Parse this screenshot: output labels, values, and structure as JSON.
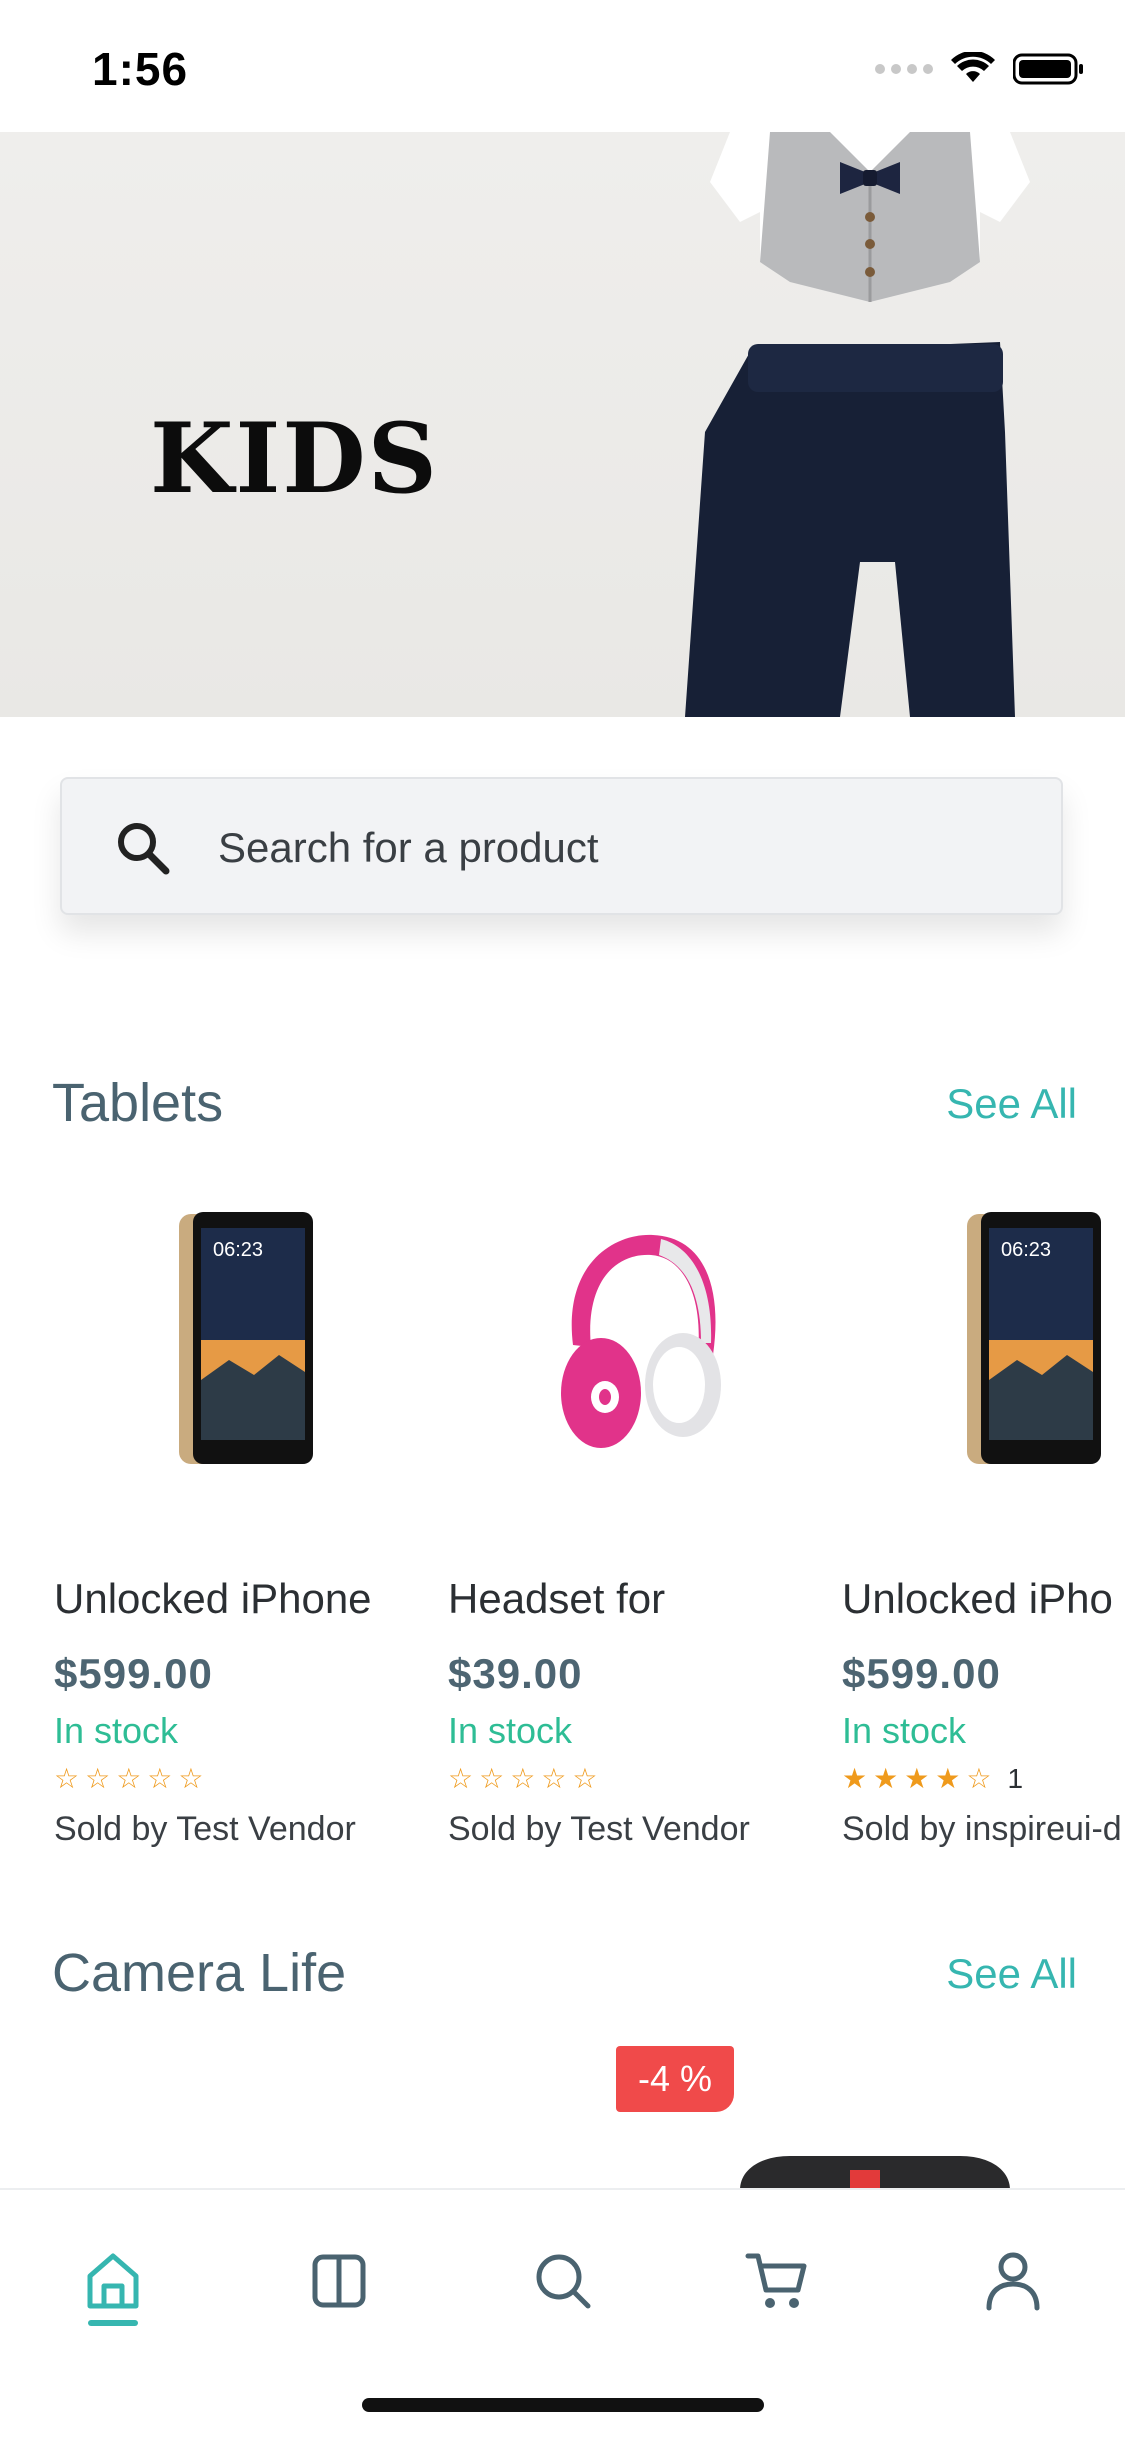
{
  "status_bar": {
    "time": "1:56"
  },
  "hero": {
    "title": "KIDS"
  },
  "search": {
    "placeholder": "Search for a product",
    "icon": "search-icon"
  },
  "sections": {
    "tablets": {
      "title": "Tablets",
      "see_all": "See All"
    },
    "camera": {
      "title": "Camera Life",
      "see_all": "See All",
      "discount": "-4 %"
    }
  },
  "products": [
    {
      "name": "Unlocked iPhone",
      "price": "$599.00",
      "stock": "In stock",
      "stars": "☆☆☆☆☆",
      "rating_count": "",
      "vendor": "Sold by Test Vendor",
      "image": "tablet"
    },
    {
      "name": "Headset for",
      "price": "$39.00",
      "stock": "In stock",
      "stars": "☆☆☆☆☆",
      "rating_count": "",
      "vendor": "Sold by Test Vendor",
      "image": "headphones"
    },
    {
      "name": "Unlocked iPho",
      "price": "$599.00",
      "stock": "In stock",
      "stars": "★★★★☆",
      "rating_count": "1",
      "vendor": "Sold by inspireui-d",
      "image": "tablet"
    }
  ],
  "nav": {
    "items": [
      "home-icon",
      "catalog-icon",
      "search-icon",
      "cart-icon",
      "profile-icon"
    ],
    "active": "home-icon"
  },
  "colors": {
    "accent": "#36b6b0",
    "stock": "#2ebd95",
    "price": "#4d6572",
    "discount": "#f04a4a",
    "star": "#ef9a1c"
  }
}
